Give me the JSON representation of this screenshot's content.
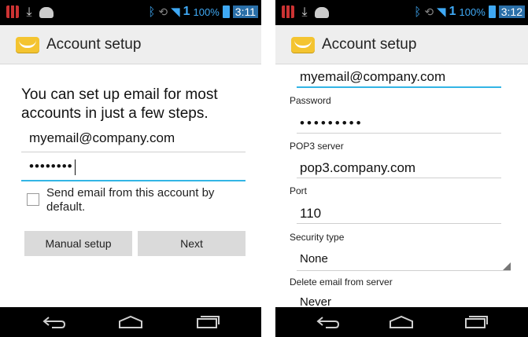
{
  "left_screen": {
    "status_bar": {
      "time": "3:11",
      "battery_pct": "100%",
      "signal": "1"
    },
    "action_bar": {
      "title": "Account setup",
      "icon": "email-envelope-icon"
    },
    "intro_text": "You can set up email for most accounts in just a few steps.",
    "email_field": {
      "value": "myemail@company.com"
    },
    "password_field": {
      "value": "••••••••"
    },
    "checkbox": {
      "label": "Send email from this account by default.",
      "checked": false
    },
    "buttons": {
      "manual_setup": "Manual setup",
      "next": "Next"
    }
  },
  "right_screen": {
    "status_bar": {
      "time": "3:12",
      "battery_pct": "100%",
      "signal": "1"
    },
    "action_bar": {
      "title": "Account setup",
      "icon": "email-envelope-icon"
    },
    "username_field": {
      "value": "myemail@company.com"
    },
    "password": {
      "label": "Password",
      "value": "•••••••••"
    },
    "pop3_server": {
      "label": "POP3 server",
      "value": "pop3.company.com"
    },
    "port": {
      "label": "Port",
      "value": "110"
    },
    "security_type": {
      "label": "Security type",
      "value": "None"
    },
    "delete_email": {
      "label": "Delete email from server",
      "value": "Never"
    }
  },
  "nav_icons": [
    "back-icon",
    "home-icon",
    "recent-apps-icon"
  ],
  "colors": {
    "accent": "#33b5e5",
    "status_blue": "#3fa9f5",
    "action_bar": "#eeeeee",
    "button": "#dadada"
  }
}
